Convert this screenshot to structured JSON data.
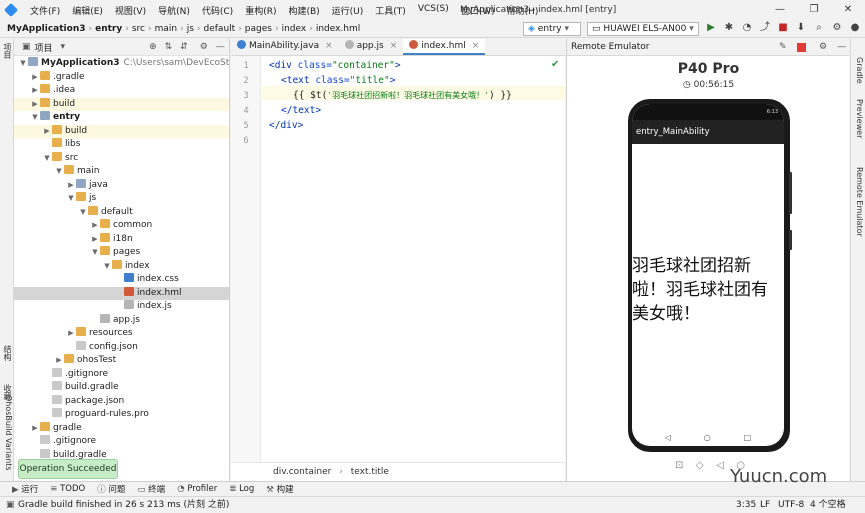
{
  "menubar": {
    "items": [
      "文件(F)",
      "编辑(E)",
      "视图(V)",
      "导航(N)",
      "代码(C)",
      "重构(R)",
      "构建(B)",
      "运行(U)",
      "工具(T)",
      "VCS(S)",
      "窗口(W)",
      "帮助(H)"
    ],
    "window_title": "MyApplication3 - index.hml [entry]",
    "minimize": "—",
    "maximize": "❐",
    "close": "✕"
  },
  "breadcrumb": [
    "MyApplication3",
    "entry",
    "src",
    "main",
    "js",
    "default",
    "pages",
    "index",
    "index.hml"
  ],
  "toolbar": {
    "config": "entry",
    "device": "HUAWEI ELS-AN00"
  },
  "left_tool": {
    "top": "项目",
    "mid1": "收藏",
    "mid2": "结构",
    "variants": "OhosBuild Variants"
  },
  "project": {
    "header_label": "项目",
    "tree": [
      {
        "label": "MyApplication3",
        "extra": "C:\\Users\\sam\\DevEcoStudioPr",
        "indent": 0,
        "arrow": "▼",
        "icon": "folderb",
        "bold": true
      },
      {
        "label": ".gradle",
        "indent": 1,
        "arrow": "▶",
        "icon": "folder"
      },
      {
        "label": ".idea",
        "indent": 1,
        "arrow": "▶",
        "icon": "folder"
      },
      {
        "label": "build",
        "indent": 1,
        "arrow": "▶",
        "icon": "folder",
        "yel": true
      },
      {
        "label": "entry",
        "indent": 1,
        "arrow": "▼",
        "icon": "folderb",
        "bold": true
      },
      {
        "label": "build",
        "indent": 2,
        "arrow": "▶",
        "icon": "folder",
        "yel": true
      },
      {
        "label": "libs",
        "indent": 2,
        "arrow": "",
        "icon": "folder"
      },
      {
        "label": "src",
        "indent": 2,
        "arrow": "▼",
        "icon": "folder"
      },
      {
        "label": "main",
        "indent": 3,
        "arrow": "▼",
        "icon": "folder"
      },
      {
        "label": "java",
        "indent": 4,
        "arrow": "▶",
        "icon": "folderb"
      },
      {
        "label": "js",
        "indent": 4,
        "arrow": "▼",
        "icon": "folder"
      },
      {
        "label": "default",
        "indent": 5,
        "arrow": "▼",
        "icon": "folder"
      },
      {
        "label": "common",
        "indent": 6,
        "arrow": "▶",
        "icon": "folder"
      },
      {
        "label": "i18n",
        "indent": 6,
        "arrow": "▶",
        "icon": "folder"
      },
      {
        "label": "pages",
        "indent": 6,
        "arrow": "▼",
        "icon": "folder"
      },
      {
        "label": "index",
        "indent": 7,
        "arrow": "▼",
        "icon": "folder"
      },
      {
        "label": "index.css",
        "indent": 8,
        "arrow": "",
        "icon": "filecss"
      },
      {
        "label": "index.hml",
        "indent": 8,
        "arrow": "",
        "icon": "filehml",
        "sel": true
      },
      {
        "label": "index.js",
        "indent": 8,
        "arrow": "",
        "icon": "filejs"
      },
      {
        "label": "app.js",
        "indent": 6,
        "arrow": "",
        "icon": "filejs"
      },
      {
        "label": "resources",
        "indent": 4,
        "arrow": "▶",
        "icon": "folder"
      },
      {
        "label": "config.json",
        "indent": 4,
        "arrow": "",
        "icon": "filegen"
      },
      {
        "label": "ohosTest",
        "indent": 3,
        "arrow": "▶",
        "icon": "folder"
      },
      {
        "label": ".gitignore",
        "indent": 2,
        "arrow": "",
        "icon": "filegen"
      },
      {
        "label": "build.gradle",
        "indent": 2,
        "arrow": "",
        "icon": "filegen"
      },
      {
        "label": "package.json",
        "indent": 2,
        "arrow": "",
        "icon": "filegen"
      },
      {
        "label": "proguard-rules.pro",
        "indent": 2,
        "arrow": "",
        "icon": "filegen"
      },
      {
        "label": "gradle",
        "indent": 1,
        "arrow": "▶",
        "icon": "folder"
      },
      {
        "label": ".gitignore",
        "indent": 1,
        "arrow": "",
        "icon": "filegen"
      },
      {
        "label": "build.gradle",
        "indent": 1,
        "arrow": "",
        "icon": "filegen"
      }
    ]
  },
  "editor": {
    "tabs": [
      {
        "label": "MainAbility.java",
        "active": false
      },
      {
        "label": "app.js",
        "active": false
      },
      {
        "label": "index.hml",
        "active": true
      }
    ],
    "line_numbers": [
      "1",
      "2",
      "3",
      "4",
      "5",
      "6"
    ],
    "lines": [
      {
        "parts": [
          {
            "t": "<div ",
            "c": "kw"
          },
          {
            "t": "class=",
            "c": "attr"
          },
          {
            "t": "\"container\"",
            "c": "str"
          },
          {
            "t": ">",
            "c": "kw"
          }
        ],
        "indent": 0
      },
      {
        "parts": [
          {
            "t": "<text ",
            "c": "kw"
          },
          {
            "t": "class=",
            "c": "attr"
          },
          {
            "t": "\"title\"",
            "c": "str"
          },
          {
            "t": ">",
            "c": "kw"
          }
        ],
        "indent": 2
      },
      {
        "parts": [
          {
            "t": "{{ $t(",
            "c": ""
          },
          {
            "t": "'羽毛球社团招新啦！羽毛球社团有美女哦！'",
            "c": "str"
          },
          {
            "t": ") }}",
            "c": ""
          }
        ],
        "indent": 4
      },
      {
        "parts": [
          {
            "t": "</text>",
            "c": "kw"
          }
        ],
        "indent": 2
      },
      {
        "parts": [
          {
            "t": "</div>",
            "c": "kw"
          }
        ],
        "indent": 0
      },
      {
        "parts": [],
        "indent": 0
      }
    ],
    "status_path": [
      "div.container",
      "text.title"
    ]
  },
  "emulator": {
    "panel_title": "Remote Emulator",
    "device_name": "P40 Pro",
    "timer": "00:56:15",
    "app_title": "entry_MainAbility",
    "app_text": "羽毛球社团招新啦！羽毛球社团有美女哦！",
    "status_time": "6:13"
  },
  "right_tool": {
    "gradle": "Gradle",
    "previewer": "Previewer",
    "remote": "Remote Emulator"
  },
  "bottom_tabs": [
    "运行",
    "TODO",
    "问题",
    "终端",
    "Profiler",
    "Log",
    "构建"
  ],
  "toast": "Operation Succeeded",
  "status": {
    "message": "Gradle build finished in 26 s 213 ms (片刻 之前)",
    "position": "3:35",
    "line_sep": "LF",
    "encoding": "UTF-8",
    "indent": "4 个空格"
  },
  "watermark": "Yuucn.com"
}
